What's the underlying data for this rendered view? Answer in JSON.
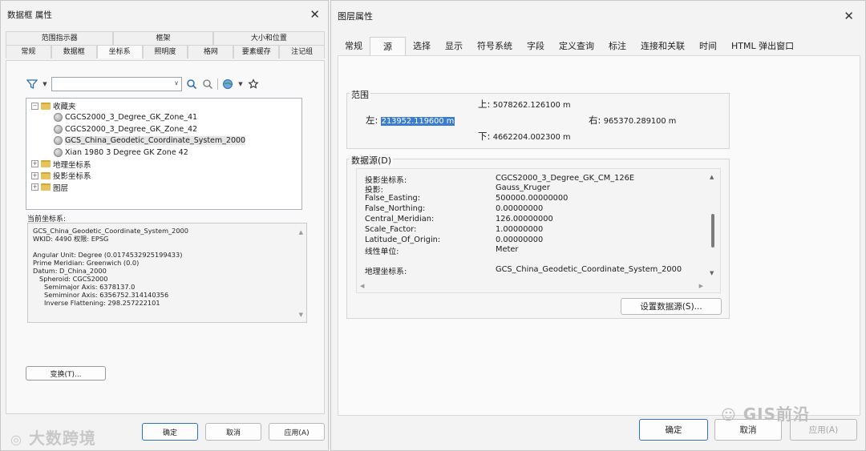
{
  "left_dialog": {
    "title": "数据框 属性",
    "close": "✕",
    "tabs_row1": [
      "范围指示器",
      "框架",
      "大小和位置"
    ],
    "tabs_row2": [
      "常规",
      "数据框",
      "坐标系",
      "照明度",
      "格网",
      "要素缓存",
      "注记组"
    ],
    "active_tab": "坐标系",
    "search_value": "",
    "tree": [
      {
        "label": "收藏夹",
        "type": "folder",
        "expanded": true
      },
      {
        "label": "CGCS2000_3_Degree_GK_Zone_41",
        "type": "globe"
      },
      {
        "label": "CGCS2000_3_Degree_GK_Zone_42",
        "type": "globe"
      },
      {
        "label": "GCS_China_Geodetic_Coordinate_System_2000",
        "type": "globe",
        "selected": true
      },
      {
        "label": "Xian 1980 3 Degree GK Zone 42",
        "type": "globe"
      },
      {
        "label": "地理坐标系",
        "type": "folder"
      },
      {
        "label": "投影坐标系",
        "type": "folder"
      },
      {
        "label": "图层",
        "type": "folder"
      }
    ],
    "current_label": "当前坐标系:",
    "current_lines": [
      "GCS_China_Geodetic_Coordinate_System_2000",
      "WKID: 4490 权限: EPSG",
      "",
      "Angular Unit: Degree (0.0174532925199433)",
      "Prime Meridian: Greenwich (0.0)",
      "Datum: D_China_2000",
      "Spheroid: CGCS2000",
      "Semimajor Axis: 6378137.0",
      "Semiminor Axis: 6356752.314140356",
      "Inverse Flattening: 298.257222101"
    ],
    "transform_button": "变换(T)...",
    "ok": "确定",
    "cancel": "取消",
    "apply": "应用(A)"
  },
  "right_dialog": {
    "title": "图层属性",
    "close": "✕",
    "tabs": [
      "常规",
      "源",
      "选择",
      "显示",
      "符号系统",
      "字段",
      "定义查询",
      "标注",
      "连接和关联",
      "时间",
      "HTML 弹出窗口"
    ],
    "active_tab": "源",
    "extent": {
      "label": "范围",
      "top_label": "上:",
      "top": "5078262.126100 m",
      "left_label": "左:",
      "left": "213952.119600 m",
      "right_label": "右:",
      "right": "965370.289100 m",
      "bottom_label": "下:",
      "bottom": "4662204.002300 m"
    },
    "datasource": {
      "label": "数据源(D)",
      "rows": [
        {
          "k": "投影坐标系:",
          "v": "CGCS2000_3_Degree_GK_CM_126E"
        },
        {
          "k": "投影:",
          "v": "Gauss_Kruger"
        },
        {
          "k": "False_Easting:",
          "v": "500000.00000000"
        },
        {
          "k": "False_Northing:",
          "v": "0.00000000"
        },
        {
          "k": "Central_Meridian:",
          "v": "126.00000000"
        },
        {
          "k": "Scale_Factor:",
          "v": "1.00000000"
        },
        {
          "k": "Latitude_Of_Origin:",
          "v": "0.00000000"
        },
        {
          "k": "线性单位:",
          "v": "Meter"
        },
        {
          "k": "地理坐标系:",
          "v": "GCS_China_Geodetic_Coordinate_System_2000"
        }
      ],
      "set_button": "设置数据源(S)..."
    },
    "ok": "确定",
    "cancel": "取消",
    "apply": "应用(A)"
  },
  "watermarks": {
    "left": "大数跨境",
    "right": "GIS前沿"
  }
}
